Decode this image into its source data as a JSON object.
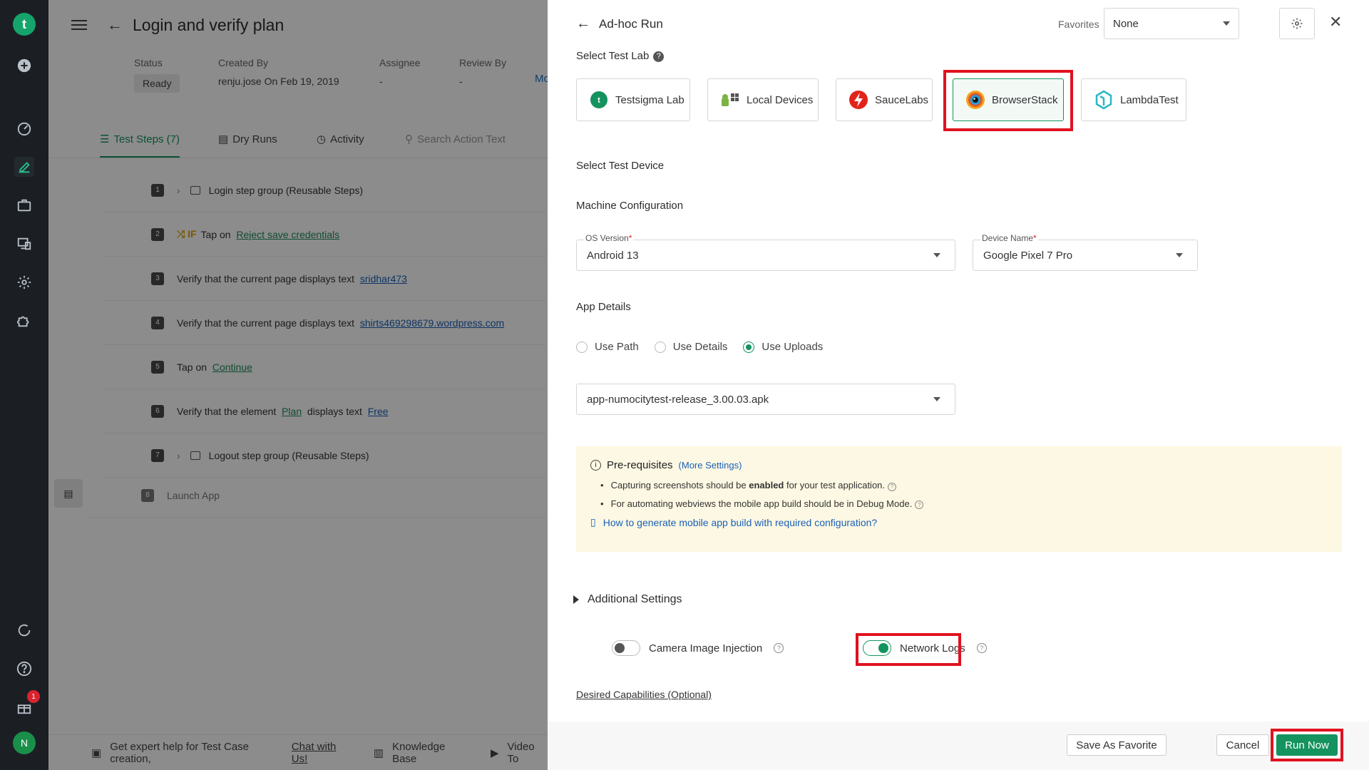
{
  "nav": {
    "logo_letter": "t",
    "items": [
      "add-icon",
      "dashboard-icon",
      "edit-icon",
      "briefcase-icon",
      "devices-icon",
      "settings-icon",
      "puzzle-icon"
    ],
    "bottom": {
      "badge_count": "1",
      "avatar_letter": "N"
    }
  },
  "page": {
    "title": "Login and verify plan",
    "meta": {
      "status_label": "Status",
      "status_value": "Ready",
      "created_label": "Created By",
      "created_user": "renju.jose",
      "created_date": "On Feb 19, 2019",
      "assignee_label": "Assignee",
      "assignee_value": "-",
      "review_label": "Review By",
      "review_value": "-",
      "more_truncated": "Mo"
    },
    "tabs": [
      {
        "label": "Test Steps (7)"
      },
      {
        "label": "Dry Runs"
      },
      {
        "label": "Activity"
      }
    ],
    "search_placeholder": "Search Action Text",
    "steps": [
      {
        "num": "1",
        "text": "Login step group (Reusable Steps)"
      },
      {
        "num": "2",
        "if": "IF",
        "pre": "Tap on",
        "link": "Reject save credentials"
      },
      {
        "num": "3",
        "pre": "Verify that the current page displays text",
        "link": "sridhar473"
      },
      {
        "num": "4",
        "pre": "Verify that the current page displays text",
        "link": "shirts469298679.wordpress.com"
      },
      {
        "num": "5",
        "pre": "Tap on",
        "link": "Continue"
      },
      {
        "num": "6",
        "pre": "Verify that the element",
        "link": "Plan",
        "mid": "displays text",
        "link2": "Free"
      },
      {
        "num": "7",
        "text": "Logout step group (Reusable Steps)"
      },
      {
        "num": "8",
        "text": "Launch App"
      }
    ],
    "footer": {
      "help_text": "Get expert help for Test Case creation,",
      "chat_link": "Chat with Us!",
      "kb": "Knowledge Base",
      "video": "Video To"
    }
  },
  "drawer": {
    "title": "Ad-hoc Run",
    "favorites_label": "Favorites",
    "favorites_value": "None",
    "select_lab_label": "Select Test Lab",
    "labs": [
      "Testsigma Lab",
      "Local Devices",
      "SauceLabs",
      "BrowserStack",
      "LambdaTest"
    ],
    "select_device_label": "Select Test Device",
    "machine_config_label": "Machine Configuration",
    "os_label": "OS Version",
    "os_value": "Android 13",
    "device_label": "Device Name",
    "device_value": "Google Pixel 7 Pro",
    "app_details_label": "App Details",
    "app_options": [
      "Use Path",
      "Use Details",
      "Use Uploads"
    ],
    "app_selected": "Use Uploads",
    "app_file": "app-numocitytest-release_3.00.03.apk",
    "prereq": {
      "title": "Pre-requisites",
      "more": "(More Settings)",
      "item1_a": "Capturing screenshots should be",
      "item1_b": "enabled",
      "item1_c": "for your test application.",
      "item2": "For automating webviews the mobile app build should be in Debug Mode.",
      "howto": "How to generate mobile app build with required configuration?"
    },
    "additional_settings": "Additional Settings",
    "camera_label": "Camera Image Injection",
    "camera_on": false,
    "network_label": "Network Logs",
    "network_on": true,
    "desired_caps": "Desired Capabilities (Optional)",
    "buttons": {
      "save_fav": "Save As Favorite",
      "cancel": "Cancel",
      "run": "Run Now"
    },
    "highlight_color": "#e0121f",
    "accent_color": "#14935f"
  }
}
